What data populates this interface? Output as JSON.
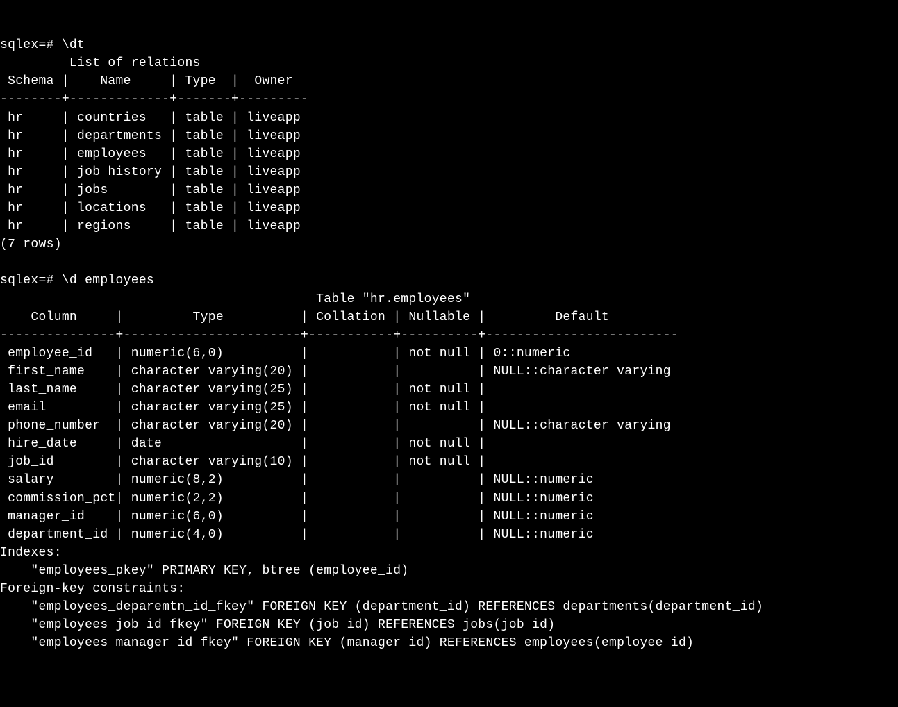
{
  "prompt1": "sqlex=# \\dt",
  "relations_title": "         List of relations",
  "relations_header": " Schema |    Name     | Type  |  Owner",
  "relations_divider": "--------+-------------+-------+---------",
  "relations_rows": [
    " hr     | countries   | table | liveapp",
    " hr     | departments | table | liveapp",
    " hr     | employees   | table | liveapp",
    " hr     | job_history | table | liveapp",
    " hr     | jobs        | table | liveapp",
    " hr     | locations   | table | liveapp",
    " hr     | regions     | table | liveapp"
  ],
  "relations_count": "(7 rows)",
  "prompt2": "sqlex=# \\d employees",
  "table_title": "                                         Table \"hr.employees\"",
  "table_header": "    Column     |         Type          | Collation | Nullable |         Default",
  "table_divider": "---------------+-----------------------+-----------+----------+-------------------------",
  "table_rows": [
    " employee_id   | numeric(6,0)          |           | not null | 0::numeric",
    " first_name    | character varying(20) |           |          | NULL::character varying",
    " last_name     | character varying(25) |           | not null |",
    " email         | character varying(25) |           | not null |",
    " phone_number  | character varying(20) |           |          | NULL::character varying",
    " hire_date     | date                  |           | not null |",
    " job_id        | character varying(10) |           | not null |",
    " salary        | numeric(8,2)          |           |          | NULL::numeric",
    " commission_pct| numeric(2,2)          |           |          | NULL::numeric",
    " manager_id    | numeric(6,0)          |           |          | NULL::numeric",
    " department_id | numeric(4,0)          |           |          | NULL::numeric"
  ],
  "indexes_label": "Indexes:",
  "indexes_line": "    \"employees_pkey\" PRIMARY KEY, btree (employee_id)",
  "fk_label": "Foreign-key constraints:",
  "fk_lines": [
    "    \"employees_deparemtn_id_fkey\" FOREIGN KEY (department_id) REFERENCES departments(department_id)",
    "    \"employees_job_id_fkey\" FOREIGN KEY (job_id) REFERENCES jobs(job_id)",
    "    \"employees_manager_id_fkey\" FOREIGN KEY (manager_id) REFERENCES employees(employee_id)"
  ]
}
